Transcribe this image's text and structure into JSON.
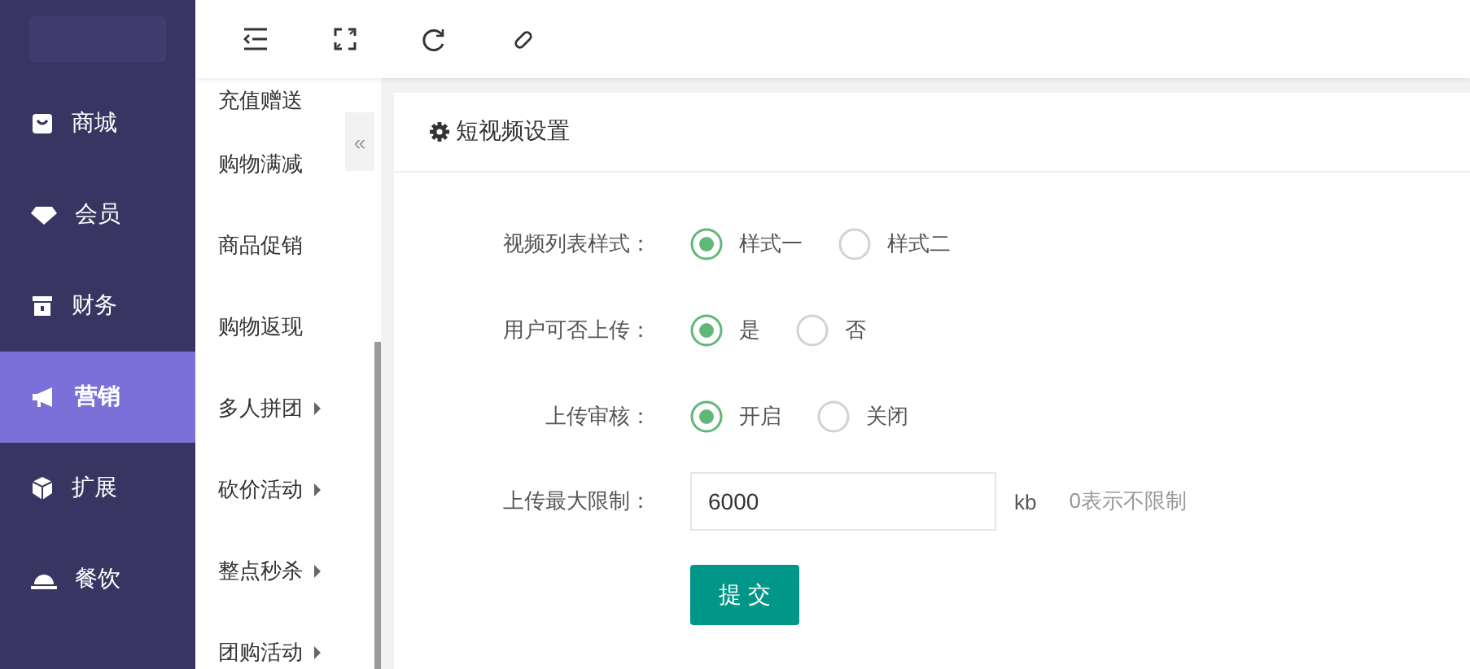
{
  "sidebar": {
    "items": [
      {
        "label": "商城",
        "selected": false
      },
      {
        "label": "会员",
        "selected": false
      },
      {
        "label": "财务",
        "selected": false
      },
      {
        "label": "营销",
        "selected": true
      },
      {
        "label": "扩展",
        "selected": false
      },
      {
        "label": "餐饮",
        "selected": false
      }
    ]
  },
  "submenu": {
    "collapse": "«",
    "items": [
      {
        "label": "充值赠送",
        "expandable": false
      },
      {
        "label": "购物满减",
        "expandable": false
      },
      {
        "label": "商品促销",
        "expandable": false
      },
      {
        "label": "购物返现",
        "expandable": false
      },
      {
        "label": "多人拼团",
        "expandable": true
      },
      {
        "label": "砍价活动",
        "expandable": true
      },
      {
        "label": "整点秒杀",
        "expandable": true
      },
      {
        "label": "团购活动",
        "expandable": true
      }
    ]
  },
  "card": {
    "title": "短视频设置",
    "fields": [
      {
        "kind": "radio",
        "label": "视频列表样式：",
        "options": [
          {
            "label": "样式一",
            "selected": true
          },
          {
            "label": "样式二",
            "selected": false
          }
        ]
      },
      {
        "kind": "radio",
        "label": "用户可否上传：",
        "options": [
          {
            "label": "是",
            "selected": true
          },
          {
            "label": "否",
            "selected": false
          }
        ]
      },
      {
        "kind": "radio",
        "label": "上传审核：",
        "options": [
          {
            "label": "开启",
            "selected": true
          },
          {
            "label": "关闭",
            "selected": false
          }
        ]
      },
      {
        "kind": "number",
        "label": "上传最大限制：",
        "value": "6000",
        "unit": "kb",
        "hint": "0表示不限制"
      }
    ],
    "submit": "提 交"
  }
}
